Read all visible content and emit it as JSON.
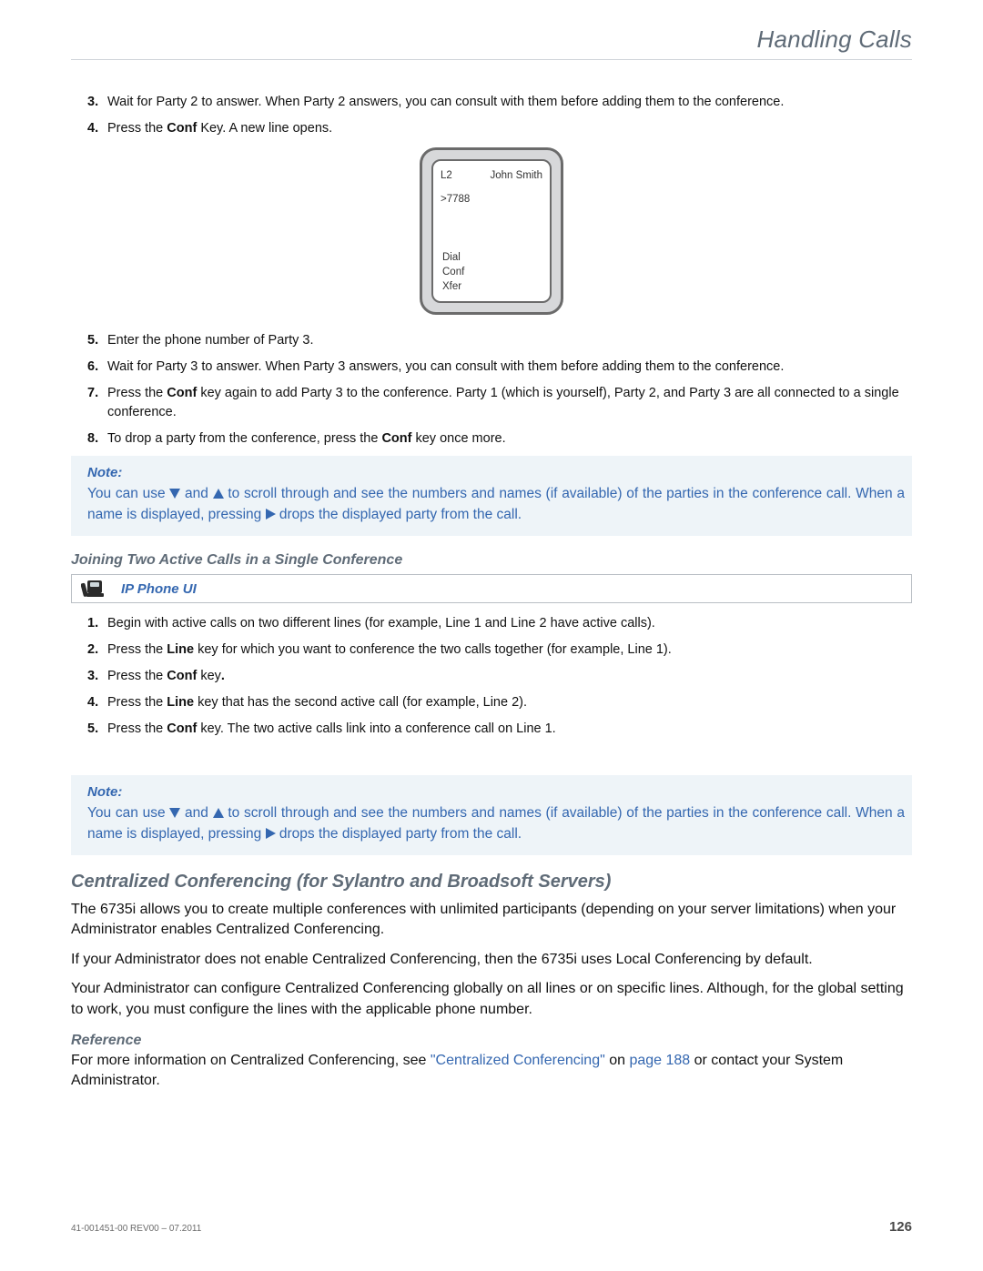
{
  "header": {
    "title": "Handling Calls"
  },
  "stepsA": [
    {
      "n": "3.",
      "html": "Wait for Party 2 to answer. When Party 2 answers, you can consult with them before adding them to the conference."
    },
    {
      "n": "4.",
      "html": "Press the <b>Conf</b> Key. A new line opens."
    }
  ],
  "phone": {
    "line": "L2",
    "caller": "John Smith",
    "number": ">7788",
    "options": [
      "Dial",
      "Conf",
      "Xfer"
    ]
  },
  "stepsB": [
    {
      "n": "5.",
      "html": "Enter the phone number of Party 3."
    },
    {
      "n": "6.",
      "html": "Wait for Party 3 to answer. When Party 3 answers, you can consult with them before adding them to the conference."
    },
    {
      "n": "7.",
      "html": "Press the <b>Conf</b> key again to add Party 3 to the conference. Party 1 (which is yourself), Party 2, and Party 3 are all connected to a single conference."
    },
    {
      "n": "8.",
      "html": "To drop a party from the conference, press the <b>Conf</b> key once more."
    }
  ],
  "note1": {
    "label": "Note:",
    "text_a": "You can use ",
    "text_b": " and ",
    "text_c": " to scroll through and see the numbers and names (if available) of the parties in the conference call. When a name is displayed, pressing ",
    "text_d": " drops the displayed party from the call."
  },
  "subHeading1": "Joining Two Active Calls in a Single Conference",
  "ipPhoneLabel": "IP Phone UI",
  "stepsC": [
    {
      "n": "1.",
      "html": "Begin with active calls on two different lines (for example, Line 1 and Line 2 have active calls)."
    },
    {
      "n": "2.",
      "html": "Press the <b>Line</b> key for which you want to conference the two calls together (for example, Line 1)."
    },
    {
      "n": "3.",
      "html": "Press the <b>Conf</b> key<b>.</b>"
    },
    {
      "n": "4.",
      "html": "Press the <b>Line</b> key that has the second active call (for example, Line 2)."
    },
    {
      "n": "5.",
      "html": "Press the <b>Conf</b> key. The two active calls link into a conference call on Line 1."
    }
  ],
  "note2": {
    "label": "Note:",
    "text_a": "You can use ",
    "text_b": " and ",
    "text_c": " to scroll through and see the numbers and names (if available) of the parties in the conference call. When a name is displayed, pressing ",
    "text_d": " drops the displayed party from the call."
  },
  "sectionHeading": "Centralized Conferencing (for Sylantro and Broadsoft Servers)",
  "para1": "The 6735i allows you to create multiple conferences with unlimited participants (depending on your server limitations) when your Administrator enables Centralized Conferencing.",
  "para2": "If your Administrator does not enable Centralized Conferencing, then the 6735i uses Local Conferencing by default.",
  "para3": "Your Administrator can configure Centralized Conferencing globally on all lines or on specific lines. Although, for the global setting to work, you must configure the lines with the applicable phone number.",
  "refHeading": "Reference",
  "refText_a": "For more information on Centralized Conferencing, see ",
  "refLink1": "\"Centralized Conferencing\"",
  "refText_b": " on ",
  "refLink2": "page 188",
  "refText_c": " or contact your System Administrator.",
  "footer": {
    "doc": "41-001451-00 REV00 – 07.2011",
    "page": "126"
  }
}
